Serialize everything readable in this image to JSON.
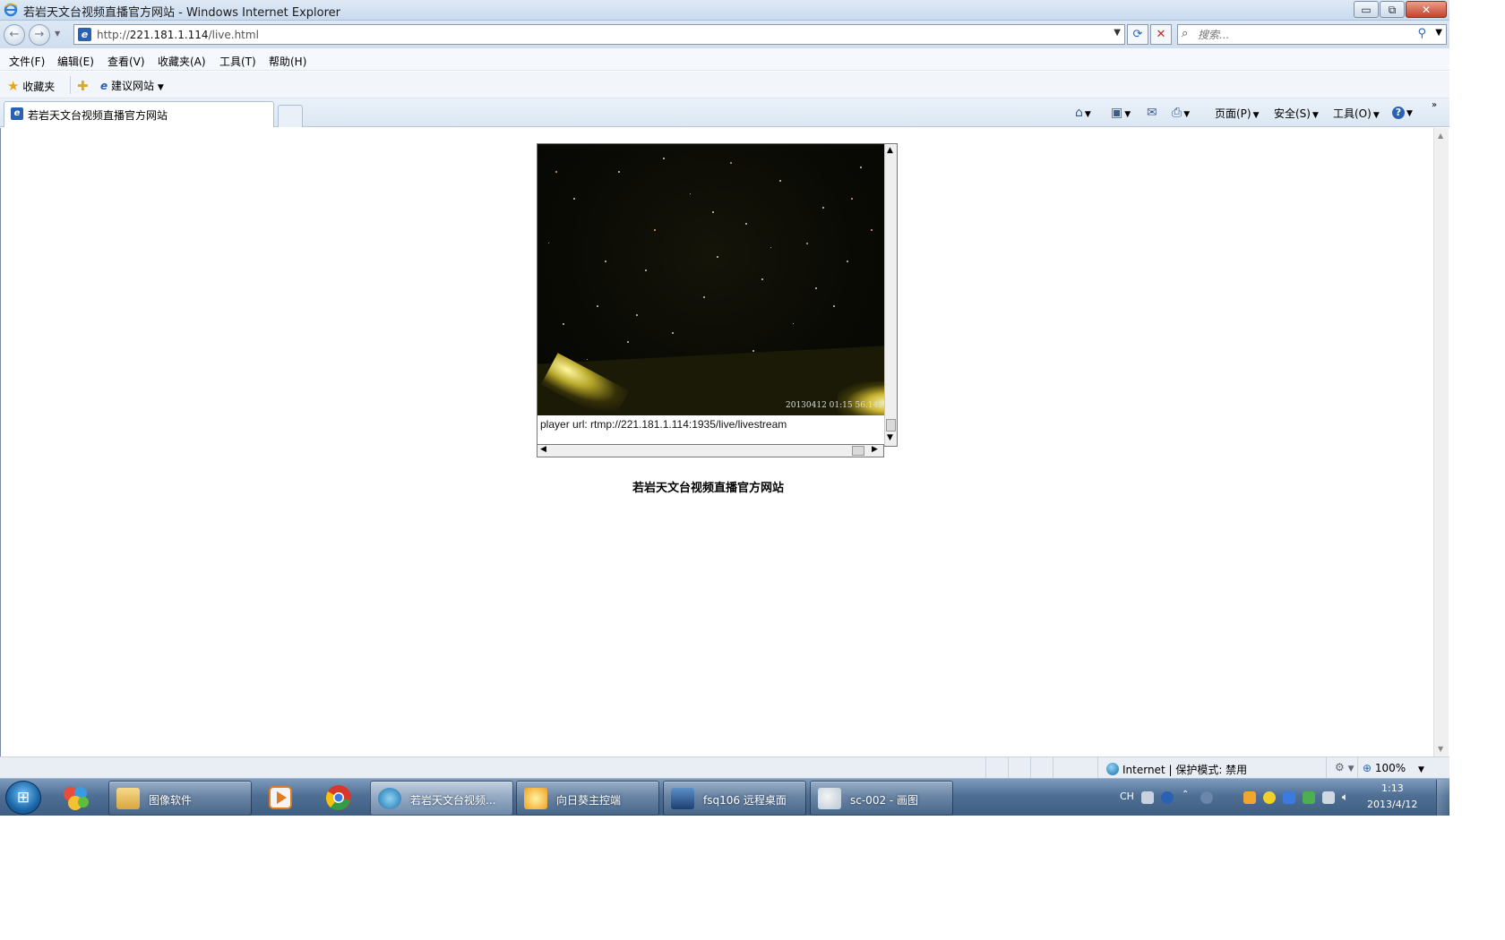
{
  "window": {
    "title": "若岩天文台视频直播官方网站 - Windows Internet Explorer",
    "minimize_label": "▭",
    "restore_label": "⧉",
    "close_label": "✕"
  },
  "nav": {
    "back_label": "←",
    "forward_label": "→",
    "url_prefix": "http://",
    "url_host": "221.181.1.114",
    "url_path": "/live.html",
    "search_placeholder": "搜索..."
  },
  "menu": {
    "items": [
      "文件(F)",
      "编辑(E)",
      "查看(V)",
      "收藏夹(A)",
      "工具(T)",
      "帮助(H)"
    ]
  },
  "favorites": {
    "favorites_label": "收藏夹",
    "suggested_sites_label": "建议网站"
  },
  "tabs": {
    "active_tab_label": "若岩天文台视频直播官方网站"
  },
  "command_bar": {
    "page_label": "页面(P)",
    "safety_label": "安全(S)",
    "tools_label": "工具(O)"
  },
  "content": {
    "video_timestamp": "20130412 01:15 56.140",
    "player_url": "player url: rtmp://221.181.1.114:1935/live/livestream",
    "page_heading": "若岩天文台视频直播官方网站"
  },
  "status_bar": {
    "zone_label": "Internet | 保护模式: 禁用",
    "zoom_label": "100%"
  },
  "taskbar": {
    "buttons": [
      {
        "label": "图像软件"
      },
      {
        "label": "若岩天文台视频..."
      },
      {
        "label": "向日葵主控端"
      },
      {
        "label": "fsq106  远程桌面"
      },
      {
        "label": "sc-002 - 画图"
      }
    ],
    "tray_lang": "CH",
    "clock_time": "1:13",
    "clock_date": "2013/4/12"
  },
  "colors": {
    "accent": "#2a62b3",
    "taskbar": "#4f6f95",
    "video_bg": "#0a0a05"
  },
  "icons": [
    "ie-icon",
    "back-icon",
    "forward-icon",
    "refresh-icon",
    "stop-icon",
    "search-icon",
    "star-icon",
    "home-icon",
    "feeds-icon",
    "mail-icon",
    "print-icon",
    "help-icon",
    "globe-icon",
    "zoom-icon",
    "windows-start-icon"
  ]
}
